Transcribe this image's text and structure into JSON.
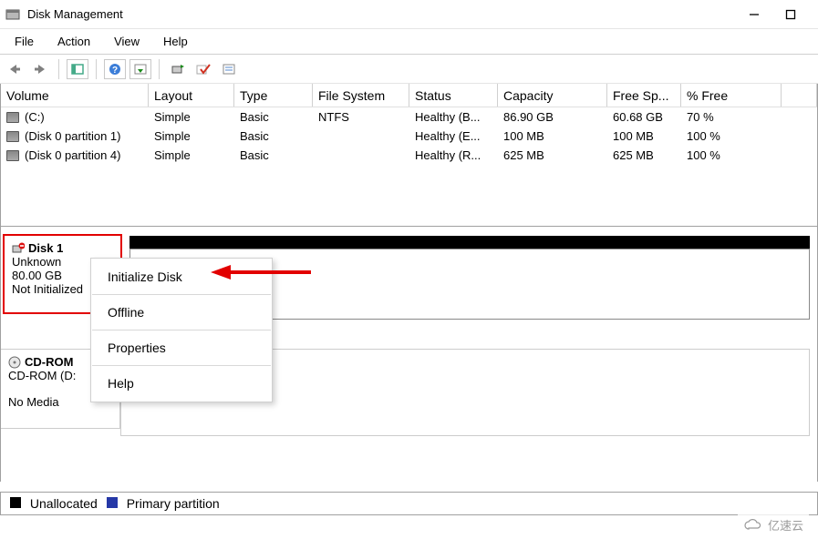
{
  "window": {
    "title": "Disk Management",
    "min_icon": "−",
    "max_icon": "□",
    "close_icon": "✕"
  },
  "menu": {
    "file": "File",
    "action": "Action",
    "view": "View",
    "help": "Help"
  },
  "columns": {
    "0": "Volume",
    "1": "Layout",
    "2": "Type",
    "3": "File System",
    "4": "Status",
    "5": "Capacity",
    "6": "Free Sp...",
    "7": "% Free"
  },
  "rows": [
    {
      "volume": "(C:)",
      "layout": "Simple",
      "type": "Basic",
      "fs": "NTFS",
      "status": "Healthy (B...",
      "capacity": "86.90 GB",
      "free": "60.68 GB",
      "pct": "70 %"
    },
    {
      "volume": "(Disk 0 partition 1)",
      "layout": "Simple",
      "type": "Basic",
      "fs": "",
      "status": "Healthy (E...",
      "capacity": "100 MB",
      "free": "100 MB",
      "pct": "100 %"
    },
    {
      "volume": "(Disk 0 partition 4)",
      "layout": "Simple",
      "type": "Basic",
      "fs": "",
      "status": "Healthy (R...",
      "capacity": "625 MB",
      "free": "625 MB",
      "pct": "100 %"
    }
  ],
  "disk1": {
    "name": "Disk 1",
    "line1": "Unknown",
    "line2": "80.00 GB",
    "line3": "Not Initialized"
  },
  "cdrom": {
    "name": "CD-ROM",
    "line1": "CD-ROM (D:",
    "nomedia": "No Media"
  },
  "context_menu": {
    "initialize": "Initialize Disk",
    "offline": "Offline",
    "properties": "Properties",
    "help": "Help"
  },
  "legend": {
    "unallocated": "Unallocated",
    "primary": "Primary partition"
  },
  "watermark": "亿速云"
}
